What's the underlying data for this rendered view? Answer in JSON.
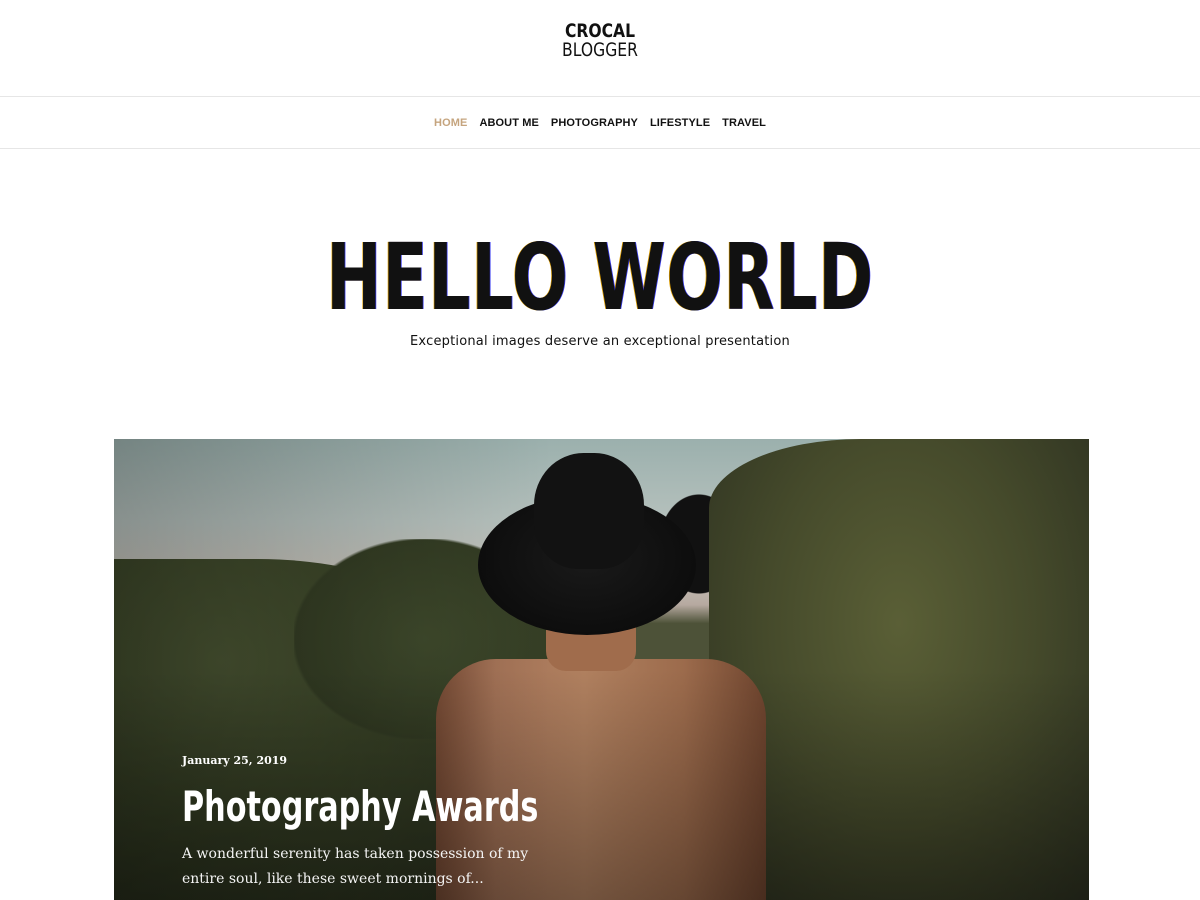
{
  "site": {
    "logo_top": "CROCAL",
    "logo_bottom": "BLOGGER"
  },
  "nav": {
    "items": [
      {
        "label": "HOME",
        "active": true
      },
      {
        "label": "ABOUT ME",
        "active": false
      },
      {
        "label": "PHOTOGRAPHY",
        "active": false
      },
      {
        "label": "LIFESTYLE",
        "active": false
      },
      {
        "label": "TRAVEL",
        "active": false
      }
    ],
    "active_color": "#c5a47e"
  },
  "hero": {
    "title": "HELLO WORLD",
    "subtitle": "Exceptional images deserve an exceptional presentation"
  },
  "featured_post": {
    "date": "January 25, 2019",
    "title": "Photography Awards",
    "excerpt": "A wonderful serenity has taken possession of my entire soul, like these sweet mornings of..."
  }
}
